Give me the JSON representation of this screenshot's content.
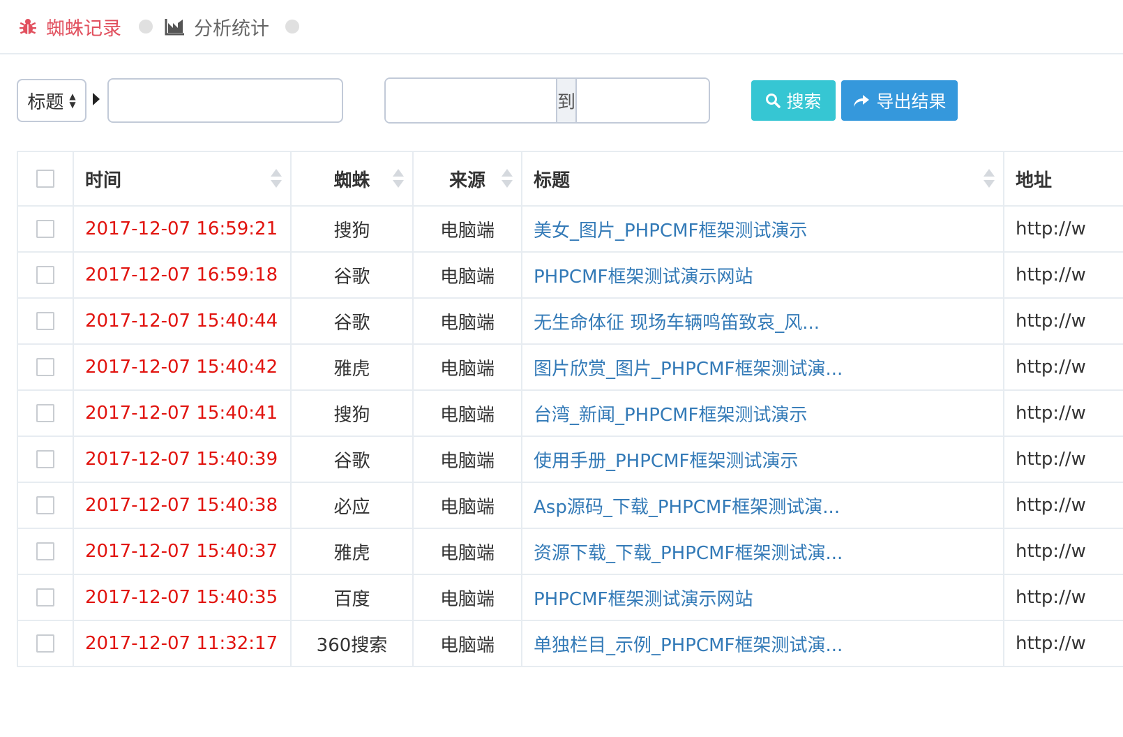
{
  "tabs": [
    {
      "label": "蜘蛛记录",
      "icon": "bug-icon",
      "active": true
    },
    {
      "label": "分析统计",
      "icon": "chart-area-icon",
      "active": false
    }
  ],
  "search": {
    "field_select": "标题",
    "keyword_value": "",
    "range_sep": "到",
    "search_label": "搜索",
    "export_label": "导出结果"
  },
  "colors": {
    "accent_tab": "#e1505e",
    "time": "#e1140f",
    "link": "#337ab7",
    "search_btn": "#36c6d3",
    "export_btn": "#3598dc"
  },
  "table": {
    "headers": [
      "时间",
      "蜘蛛",
      "来源",
      "标题",
      "地址"
    ],
    "rows": [
      {
        "time": "2017-12-07 16:59:21",
        "spider": "搜狗",
        "source": "电脑端",
        "title": "美女_图片_PHPCMF框架测试演示",
        "url": "http://w"
      },
      {
        "time": "2017-12-07 16:59:18",
        "spider": "谷歌",
        "source": "电脑端",
        "title": "PHPCMF框架测试演示网站",
        "url": "http://w"
      },
      {
        "time": "2017-12-07 15:40:44",
        "spider": "谷歌",
        "source": "电脑端",
        "title": "无生命体征 现场车辆鸣笛致哀_风...",
        "url": "http://w"
      },
      {
        "time": "2017-12-07 15:40:42",
        "spider": "雅虎",
        "source": "电脑端",
        "title": "图片欣赏_图片_PHPCMF框架测试演...",
        "url": "http://w"
      },
      {
        "time": "2017-12-07 15:40:41",
        "spider": "搜狗",
        "source": "电脑端",
        "title": "台湾_新闻_PHPCMF框架测试演示",
        "url": "http://w"
      },
      {
        "time": "2017-12-07 15:40:39",
        "spider": "谷歌",
        "source": "电脑端",
        "title": "使用手册_PHPCMF框架测试演示",
        "url": "http://w"
      },
      {
        "time": "2017-12-07 15:40:38",
        "spider": "必应",
        "source": "电脑端",
        "title": "Asp源码_下载_PHPCMF框架测试演...",
        "url": "http://w"
      },
      {
        "time": "2017-12-07 15:40:37",
        "spider": "雅虎",
        "source": "电脑端",
        "title": "资源下载_下载_PHPCMF框架测试演...",
        "url": "http://w"
      },
      {
        "time": "2017-12-07 15:40:35",
        "spider": "百度",
        "source": "电脑端",
        "title": "PHPCMF框架测试演示网站",
        "url": "http://w"
      },
      {
        "time": "2017-12-07 11:32:17",
        "spider": "360搜索",
        "source": "电脑端",
        "title": "单独栏目_示例_PHPCMF框架测试演...",
        "url": "http://w"
      }
    ]
  }
}
